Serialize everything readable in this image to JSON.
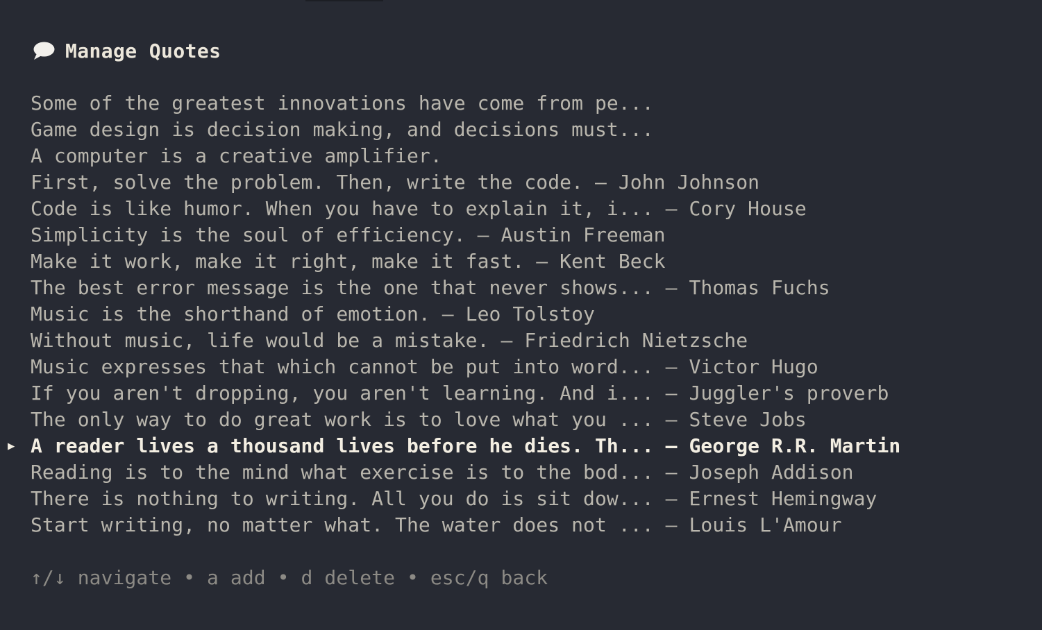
{
  "header": {
    "icon": "speech-bubble-icon",
    "title": "Manage Quotes"
  },
  "quotes": [
    {
      "text": "Some of the greatest innovations have come from pe...",
      "selected": false
    },
    {
      "text": "Game design is decision making, and decisions must...",
      "selected": false
    },
    {
      "text": "A computer is a creative amplifier.",
      "selected": false
    },
    {
      "text": "First, solve the problem. Then, write the code. — John Johnson",
      "selected": false
    },
    {
      "text": "Code is like humor. When you have to explain it, i... — Cory House",
      "selected": false
    },
    {
      "text": "Simplicity is the soul of efficiency. — Austin Freeman",
      "selected": false
    },
    {
      "text": "Make it work, make it right, make it fast. — Kent Beck",
      "selected": false
    },
    {
      "text": "The best error message is the one that never shows... — Thomas Fuchs",
      "selected": false
    },
    {
      "text": "Music is the shorthand of emotion. — Leo Tolstoy",
      "selected": false
    },
    {
      "text": "Without music, life would be a mistake. — Friedrich Nietzsche",
      "selected": false
    },
    {
      "text": "Music expresses that which cannot be put into word... — Victor Hugo",
      "selected": false
    },
    {
      "text": "If you aren't dropping, you aren't learning. And i... — Juggler's proverb",
      "selected": false
    },
    {
      "text": "The only way to do great work is to love what you ... — Steve Jobs",
      "selected": false
    },
    {
      "text": "A reader lives a thousand lives before he dies. Th... — George R.R. Martin",
      "selected": true
    },
    {
      "text": "Reading is to the mind what exercise is to the bod... — Joseph Addison",
      "selected": false
    },
    {
      "text": "There is nothing to writing. All you do is sit dow... — Ernest Hemingway",
      "selected": false
    },
    {
      "text": "Start writing, no matter what. The water does not ... — Louis L'Amour",
      "selected": false
    }
  ],
  "cursor_glyph": "▶",
  "help_text": "↑/↓ navigate • a add • d delete • esc/q back",
  "colors": {
    "background": "#272a33",
    "text": "#b9b6ad",
    "selected_text": "#f3eee2",
    "title": "#ece7db",
    "help": "#8c8a85"
  }
}
